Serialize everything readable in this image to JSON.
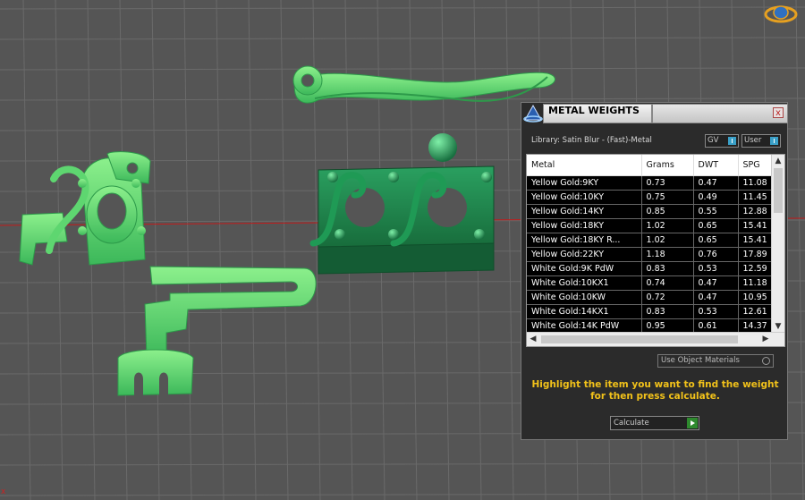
{
  "panel": {
    "title": "METAL WEIGHTS",
    "close_label": "x",
    "library_label": "Library: Satin Blur - (Fast)-Metal",
    "toggle_gv": "GV",
    "toggle_user": "User",
    "use_object_materials": "Use Object Materials",
    "hint": "Highlight the item you want to find the weight for then press calculate.",
    "calculate_label": "Calculate"
  },
  "table": {
    "columns": [
      "Metal",
      "Grams",
      "DWT",
      "SPG"
    ],
    "rows": [
      [
        "Yellow Gold:9KY",
        "0.73",
        "0.47",
        "11.08"
      ],
      [
        "Yellow Gold:10KY",
        "0.75",
        "0.49",
        "11.45"
      ],
      [
        "Yellow Gold:14KY",
        "0.85",
        "0.55",
        "12.88"
      ],
      [
        "Yellow Gold:18KY",
        "1.02",
        "0.65",
        "15.41"
      ],
      [
        "Yellow Gold:18KY R...",
        "1.02",
        "0.65",
        "15.41"
      ],
      [
        "Yellow Gold:22KY",
        "1.18",
        "0.76",
        "17.89"
      ],
      [
        "White Gold:9K PdW",
        "0.83",
        "0.53",
        "12.59"
      ],
      [
        "White Gold:10KX1",
        "0.74",
        "0.47",
        "11.18"
      ],
      [
        "White Gold:10KW",
        "0.72",
        "0.47",
        "10.95"
      ],
      [
        "White Gold:14KX1",
        "0.83",
        "0.53",
        "12.61"
      ],
      [
        "White Gold:14K PdW",
        "0.95",
        "0.61",
        "14.37"
      ]
    ]
  },
  "viewport": {
    "corner_mark": "x",
    "object_color": "#4fd46a",
    "object_color_dark": "#1f7a45",
    "grid_background": "#555555",
    "axis_color": "#d01818"
  },
  "colors": {
    "hint": "#f2c21a",
    "panel_bg": "#2b2b2b"
  }
}
